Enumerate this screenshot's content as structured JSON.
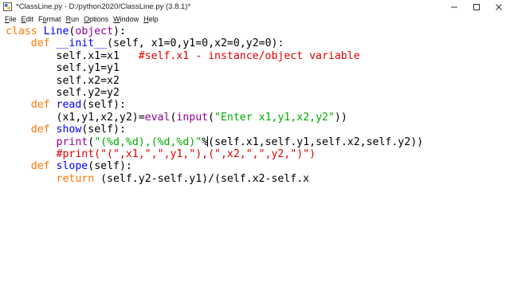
{
  "window": {
    "title": "*ClassLine.py - D:/python2020/ClassLine.py (3.8.1)*"
  },
  "menu": [
    {
      "label": "File",
      "accel": "F",
      "rest": "ile"
    },
    {
      "label": "Edit",
      "accel": "E",
      "rest": "dit"
    },
    {
      "label": "Format",
      "accel": "o",
      "pre": "F",
      "rest": "rmat"
    },
    {
      "label": "Run",
      "accel": "R",
      "rest": "un"
    },
    {
      "label": "Options",
      "accel": "O",
      "rest": "ptions"
    },
    {
      "label": "Window",
      "accel": "W",
      "rest": "indow"
    },
    {
      "label": "Help",
      "accel": "H",
      "rest": "elp"
    }
  ],
  "code": {
    "lines": [
      [
        {
          "t": "class",
          "c": "kw"
        },
        {
          "t": " "
        },
        {
          "t": "Line",
          "c": "def"
        },
        {
          "t": "("
        },
        {
          "t": "object",
          "c": "builtin"
        },
        {
          "t": "):"
        }
      ],
      [
        {
          "t": "    "
        },
        {
          "t": "def",
          "c": "kw"
        },
        {
          "t": " "
        },
        {
          "t": "__init__",
          "c": "def"
        },
        {
          "t": "(self, x1=0,y1=0,x2=0,y2=0):"
        }
      ],
      [
        {
          "t": "        self.x1=x1   "
        },
        {
          "t": "#self.x1 - instance/object variable",
          "c": "cmt"
        }
      ],
      [
        {
          "t": "        self.y1=y1"
        }
      ],
      [
        {
          "t": "        self.x2=x2"
        }
      ],
      [
        {
          "t": "        self.y2=y2"
        }
      ],
      [
        {
          "t": "    "
        },
        {
          "t": "def",
          "c": "kw"
        },
        {
          "t": " "
        },
        {
          "t": "read",
          "c": "def"
        },
        {
          "t": "(self):"
        }
      ],
      [
        {
          "t": "        (x1,y1,x2,y2)="
        },
        {
          "t": "eval",
          "c": "builtin"
        },
        {
          "t": "("
        },
        {
          "t": "input",
          "c": "builtin"
        },
        {
          "t": "("
        },
        {
          "t": "\"Enter x1,y1,x2,y2\"",
          "c": "str"
        },
        {
          "t": "))"
        }
      ],
      [
        {
          "t": "    "
        },
        {
          "t": "def",
          "c": "kw"
        },
        {
          "t": " "
        },
        {
          "t": "show",
          "c": "def"
        },
        {
          "t": "(self):"
        }
      ],
      [
        {
          "t": "        "
        },
        {
          "t": "print",
          "c": "builtin"
        },
        {
          "t": "("
        },
        {
          "t": "\"(%d,%d),(%d,%d)\"",
          "c": "str"
        },
        {
          "t": "%"
        },
        {
          "t": "CURSOR"
        },
        {
          "t": "(self.x1,self.y1,self.x2,self.y2))"
        }
      ],
      [
        {
          "t": "        "
        },
        {
          "t": "#print(\"(\",x1,\",\",y1,\"),(\",x2,\",\",y2,\")\")",
          "c": "cmt"
        }
      ],
      [
        {
          "t": "    "
        },
        {
          "t": "def",
          "c": "kw"
        },
        {
          "t": " "
        },
        {
          "t": "slope",
          "c": "def"
        },
        {
          "t": "(self):"
        }
      ],
      [
        {
          "t": "        "
        },
        {
          "t": "return",
          "c": "kw"
        },
        {
          "t": " (self.y2-self.y1)/(self.x2-self.x"
        }
      ]
    ]
  }
}
